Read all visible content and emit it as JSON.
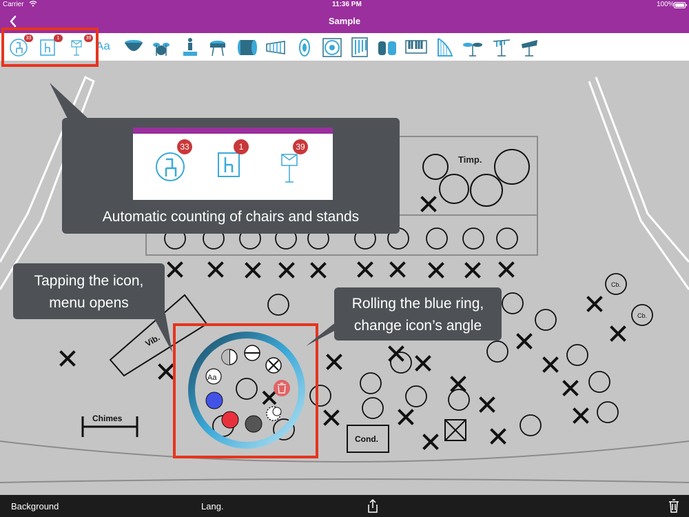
{
  "status": {
    "carrier": "Carrier",
    "time": "11:36 PM",
    "battery": "100%"
  },
  "nav": {
    "title": "Sample"
  },
  "toolbar": {
    "chair_count": "33",
    "stand_chair_count": "1",
    "music_stand_count": "39",
    "text_tool_label": "Aa"
  },
  "zoom_panel": {
    "chair_count": "33",
    "stand_chair_count": "1",
    "music_stand_count": "39"
  },
  "callouts": {
    "counting": "Automatic counting of chairs and stands",
    "tapping": "Tapping the icon, menu opens",
    "rolling": "Rolling the blue ring, change icon’s angle"
  },
  "stage": {
    "timp_label": "Timp.",
    "vib_label": "Vib.",
    "chimes_label": "Chimes",
    "cond_label": "Cond.",
    "cb_label_1": "Cb.",
    "cb_label_2": "Cb.",
    "ring_menu_text_label": "Aa"
  },
  "bottom": {
    "background_label": "Background",
    "lang_label": "Lang."
  },
  "colors": {
    "accent": "#9a2f9d",
    "highlight": "#e6341e",
    "icon_blue": "#3ba9d8",
    "badge": "#c9383a"
  }
}
